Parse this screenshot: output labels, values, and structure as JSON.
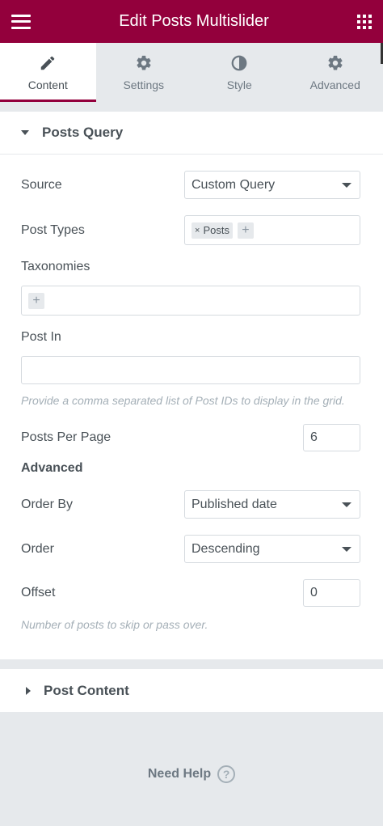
{
  "header": {
    "title": "Edit Posts Multislider"
  },
  "tabs": [
    {
      "label": "Content",
      "icon": "pencil-icon",
      "active": true
    },
    {
      "label": "Settings",
      "icon": "gear-icon",
      "active": false
    },
    {
      "label": "Style",
      "icon": "contrast-icon",
      "active": false
    },
    {
      "label": "Advanced",
      "icon": "gear-icon",
      "active": false
    }
  ],
  "posts_query": {
    "title": "Posts Query",
    "source": {
      "label": "Source",
      "value": "Custom Query"
    },
    "post_types": {
      "label": "Post Types",
      "tags": [
        "Posts"
      ]
    },
    "taxonomies": {
      "label": "Taxonomies"
    },
    "post_in": {
      "label": "Post In",
      "value": "",
      "hint": "Provide a comma separated list of Post IDs to display in the grid."
    },
    "posts_per_page": {
      "label": "Posts Per Page",
      "value": "6"
    },
    "advanced_title": "Advanced",
    "order_by": {
      "label": "Order By",
      "value": "Published date"
    },
    "order": {
      "label": "Order",
      "value": "Descending"
    },
    "offset": {
      "label": "Offset",
      "value": "0",
      "hint": "Number of posts to skip or pass over."
    }
  },
  "post_content": {
    "title": "Post Content"
  },
  "help": {
    "label": "Need Help",
    "icon": "question-icon"
  },
  "colors": {
    "brand": "#93003c",
    "panel_bg": "#e6e9ec"
  }
}
